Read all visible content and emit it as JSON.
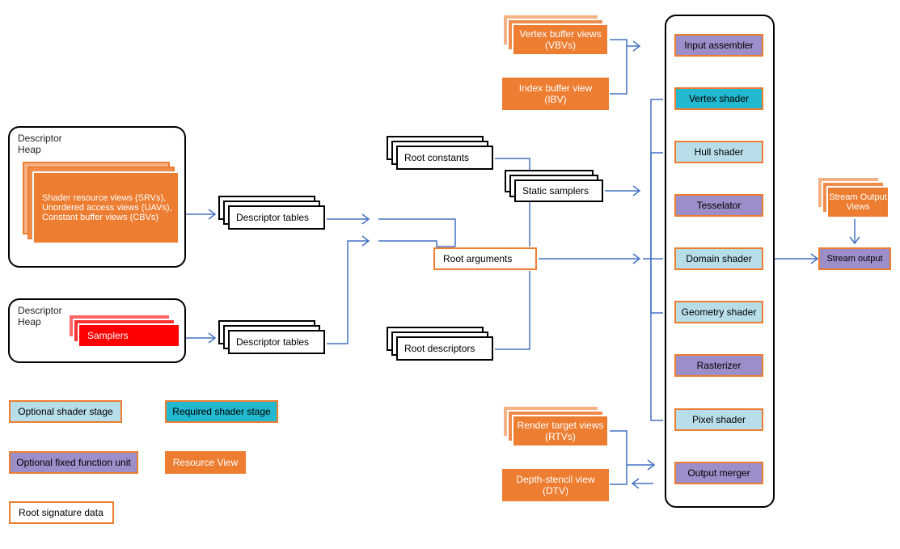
{
  "descriptor_heap_1": {
    "title": "Descriptor\nHeap",
    "content": "Shader resource views (SRVs),\nUnordered access views (UAVs),\nConstant buffer views (CBVs)"
  },
  "descriptor_heap_2": {
    "title": "Descriptor\nHeap",
    "content": "Samplers"
  },
  "descriptor_tables_1": "Descriptor tables",
  "descriptor_tables_2": "Descriptor tables",
  "root_constants": "Root constants",
  "root_descriptors": "Root descriptors",
  "root_arguments": "Root arguments",
  "static_samplers": "Static samplers",
  "vbv": "Vertex buffer views\n(VBVs)",
  "ibv": "Index buffer view\n(IBV)",
  "rtv": "Render target views\n(RTVs)",
  "dtv": "Depth-stencil view\n(DTV)",
  "stream_output_views": "Stream Output\nViews",
  "pipeline": {
    "input_assembler": "Input assembler",
    "vertex_shader": "Vertex shader",
    "hull_shader": "Hull shader",
    "tesselator": "Tesselator",
    "domain_shader": "Domain shader",
    "geometry_shader": "Geometry shader",
    "rasterizer": "Rasterizer",
    "pixel_shader": "Pixel shader",
    "output_merger": "Output merger",
    "stream_output": "Stream output"
  },
  "legend": {
    "optional_shader": "Optional shader stage",
    "required_shader": "Required shader stage",
    "optional_fixed": "Optional fixed function unit",
    "resource_view": "Resource View",
    "root_sig": "Root signature data"
  }
}
